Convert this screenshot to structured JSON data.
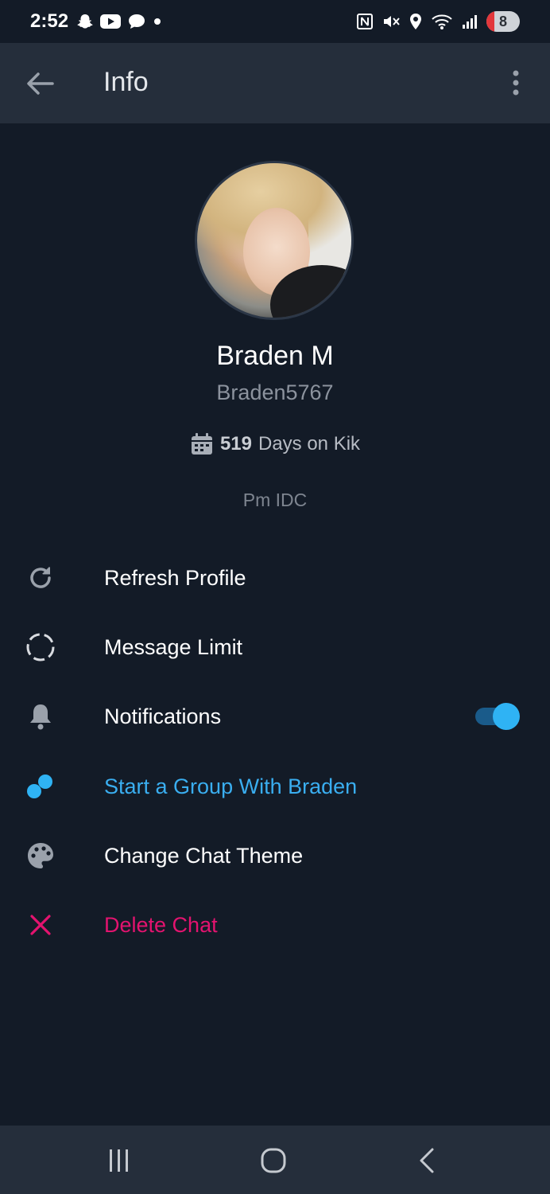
{
  "status_bar": {
    "time": "2:52",
    "battery_level": "8",
    "left_icons": [
      "snapchat-icon",
      "youtube-icon",
      "chat-bubble-icon",
      "dot-icon"
    ],
    "right_icons": [
      "nfc-icon",
      "mute-icon",
      "location-icon",
      "wifi-icon",
      "signal-icon",
      "battery-icon"
    ]
  },
  "app_bar": {
    "title": "Info"
  },
  "profile": {
    "display_name": "Braden M",
    "username": "Braden5767",
    "days_count": "519",
    "days_suffix": "Days on Kik",
    "bio": "Pm IDC"
  },
  "menu": {
    "refresh": "Refresh Profile",
    "message_limit": "Message Limit",
    "notifications": "Notifications",
    "notifications_on": true,
    "start_group": "Start a Group With Braden",
    "change_theme": "Change Chat Theme",
    "delete_chat": "Delete Chat"
  },
  "colors": {
    "background": "#131b27",
    "app_bar": "#252e3b",
    "accent_blue": "#3aaef0",
    "danger_pink": "#e3136f",
    "toggle_thumb": "#2fb3f4"
  }
}
